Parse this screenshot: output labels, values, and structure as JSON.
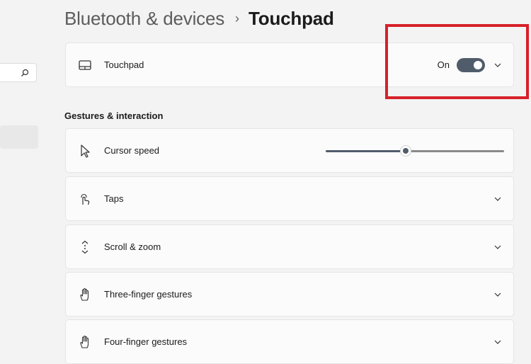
{
  "header": {
    "parent": "Bluetooth & devices",
    "separator": "›",
    "current": "Touchpad"
  },
  "touchpad_card": {
    "label": "Touchpad",
    "toggle_text": "On",
    "toggle_state": "on",
    "icon": "touchpad-icon"
  },
  "section": {
    "title": "Gestures & interaction"
  },
  "cursor_speed": {
    "label": "Cursor speed",
    "value_fraction": 0.45,
    "icon": "cursor-icon"
  },
  "rows": [
    {
      "label": "Taps",
      "icon": "tap-icon"
    },
    {
      "label": "Scroll & zoom",
      "icon": "scroll-icon"
    },
    {
      "label": "Three-finger gestures",
      "icon": "hand-icon"
    },
    {
      "label": "Four-finger gestures",
      "icon": "hand-icon"
    }
  ],
  "colors": {
    "accent": "#515c6b",
    "highlight": "#d7202a"
  }
}
